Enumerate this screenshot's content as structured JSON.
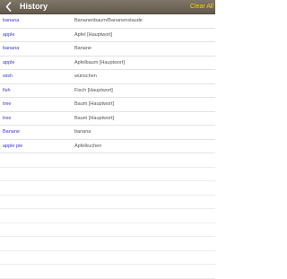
{
  "header": {
    "title": "History",
    "clear_label": "Clear All",
    "back_icon": "chevron-left-icon"
  },
  "history": [
    {
      "word": "banana",
      "translation": "Bananenbaum/Bananenstaude"
    },
    {
      "word": "apple",
      "translation": "Apfel [Hauptwort]"
    },
    {
      "word": "banana",
      "translation": "Banane"
    },
    {
      "word": "apple",
      "translation": "Apfelbaum [Hauptwort]"
    },
    {
      "word": "wish",
      "translation": "wünschen"
    },
    {
      "word": "fish",
      "translation": "Fisch [Hauptwort]"
    },
    {
      "word": "tree",
      "translation": "Baum [Hauptwort]"
    },
    {
      "word": "tree",
      "translation": "Baum [Hauptwort]"
    },
    {
      "word": "Banane",
      "translation": "banana"
    },
    {
      "word": "apple pie",
      "translation": "Apfelkuchen"
    }
  ],
  "colors": {
    "navbar": "#6f6659",
    "title": "#ffffff",
    "clear": "#f2d600",
    "word": "#3b3bd1",
    "translation": "#555555"
  }
}
